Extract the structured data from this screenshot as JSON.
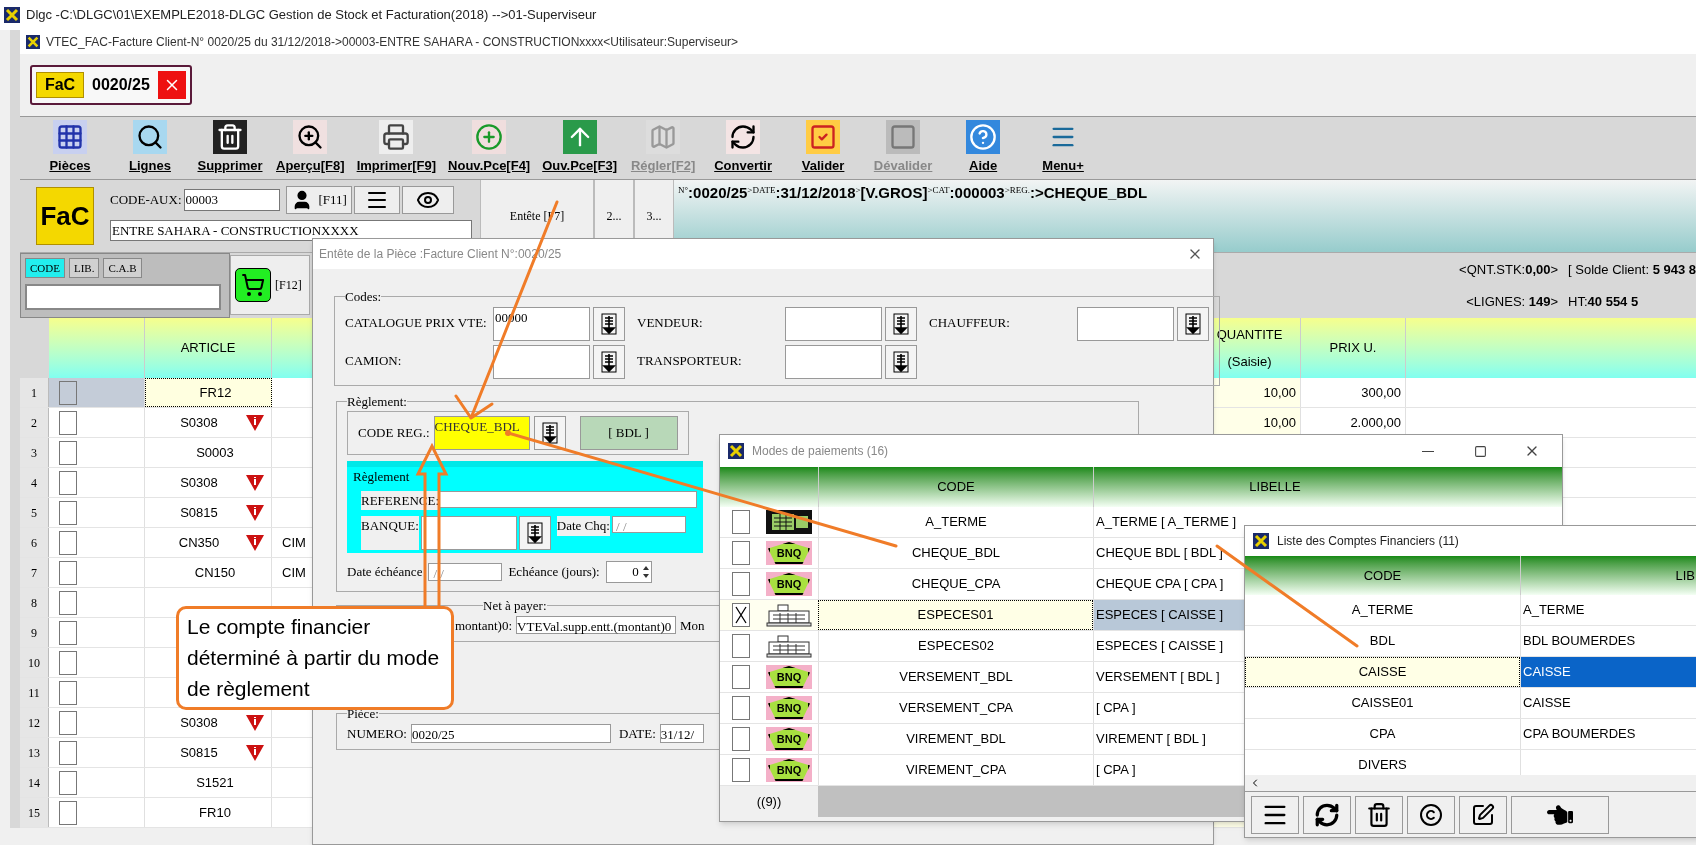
{
  "app_title": "Dlgc -C:\\DLGC\\01\\EXEMPLE2018-DLGC Gestion de Stock et Facturation(2018) -->01-Superviseur",
  "window_title": "VTEC_FAC-Facture Client-N° 0020/25 du 31/12/2018->00003-ENTRE SAHARA - CONSTRUCTIONxxxx<Utilisateur:Superviseur>",
  "doc_tab": {
    "logo": "FaC",
    "number": "0020/25"
  },
  "toolbar": [
    {
      "kind": "pieces",
      "label": "Pièces",
      "disabled": false
    },
    {
      "kind": "lines",
      "label": "Lignes",
      "disabled": false
    },
    {
      "kind": "delete",
      "label": "Supprimer",
      "disabled": false
    },
    {
      "kind": "preview",
      "label": "Aperçu[F8]",
      "disabled": false
    },
    {
      "kind": "print",
      "label": "Imprimer[F9]",
      "disabled": false
    },
    {
      "kind": "new",
      "label": "Nouv.Pce[F4]",
      "disabled": false
    },
    {
      "kind": "open",
      "label": "Ouv.Pce[F3]",
      "disabled": false
    },
    {
      "kind": "pay",
      "label": "Régler[F2]",
      "disabled": true
    },
    {
      "kind": "convert",
      "label": "Convertir",
      "disabled": false
    },
    {
      "kind": "validate",
      "label": "Valider",
      "disabled": false
    },
    {
      "kind": "unvalidate",
      "label": "Dévalider",
      "disabled": true
    },
    {
      "kind": "help",
      "label": "Aide",
      "disabled": false
    },
    {
      "kind": "menu",
      "label": "Menu+",
      "disabled": false
    }
  ],
  "header": {
    "logo": "FaC",
    "code_aux_label": "CODE-AUX:",
    "code_aux_value": "00003",
    "client_key": "[F11]",
    "client_name": "ENTRE SAHARA - CONSTRUCTIONXXXX",
    "tabs": [
      "Entête [F7]",
      "2...",
      "3..."
    ],
    "info": [
      {
        "kind": "small",
        "text": "N°"
      },
      {
        "kind": "big",
        "text": ":0020/25"
      },
      {
        "kind": "small",
        "text": ">DATE"
      },
      {
        "kind": "big",
        "text": ":31/12/2018"
      },
      {
        "kind": "small",
        "text": ">"
      },
      {
        "kind": "big",
        "text": "[V.GROS]"
      },
      {
        "kind": "small",
        "text": ">CAT"
      },
      {
        "kind": "big",
        "text": ":000003"
      },
      {
        "kind": "small",
        "text": ">REG."
      },
      {
        "kind": "big",
        "text": ":>CHEQUE_BDL"
      }
    ]
  },
  "search": {
    "modes": [
      {
        "label": "CODE",
        "selected": true
      },
      {
        "label": "LIB.",
        "selected": false
      },
      {
        "label": "C.A.B",
        "selected": false
      }
    ],
    "cart_key": "[F12]"
  },
  "stats": [
    "<QNT.STK:**0,00**>",
    "[ Solde Client: **5 943 8**",
    "<LIGNES: **149**>",
    "HT:**40 554 5**"
  ],
  "grid": {
    "columns": {
      "article": "ARTICLE",
      "quantity": "QUANTITE",
      "quantity_sub": "(Saisie)",
      "price": "PRIX U."
    },
    "rows": [
      {
        "num": "1",
        "selected": true,
        "checked": false,
        "article": "FR12",
        "alert": false,
        "quantity": "10,00",
        "price": "300,00"
      },
      {
        "num": "2",
        "selected": false,
        "checked": false,
        "article": "S0308",
        "alert": true,
        "quantity": "10,00",
        "price": "2.000,00"
      },
      {
        "num": "3",
        "selected": false,
        "checked": false,
        "article": "S0003",
        "alert": false
      },
      {
        "num": "4",
        "selected": false,
        "checked": false,
        "article": "S0308",
        "alert": true
      },
      {
        "num": "5",
        "selected": false,
        "checked": false,
        "article": "S0815",
        "alert": true
      },
      {
        "num": "6",
        "selected": false,
        "checked": false,
        "article": "CN350",
        "alert": true,
        "column_4": "CIM"
      },
      {
        "num": "7",
        "selected": false,
        "checked": false,
        "article": "CN150",
        "alert": false,
        "column_4": "CIM"
      },
      {
        "num": "8",
        "selected": false,
        "checked": false,
        "alert": false
      },
      {
        "num": "9",
        "selected": false,
        "checked": false,
        "alert": false
      },
      {
        "num": "10",
        "selected": false,
        "checked": false,
        "alert": false
      },
      {
        "num": "11",
        "selected": false,
        "checked": false,
        "alert": false
      },
      {
        "num": "12",
        "selected": false,
        "checked": false,
        "article": "S0308",
        "alert": true
      },
      {
        "num": "13",
        "selected": false,
        "checked": false,
        "article": "S0815",
        "alert": true
      },
      {
        "num": "14",
        "selected": false,
        "checked": false,
        "article": "S1521",
        "alert": false
      },
      {
        "num": "15",
        "selected": false,
        "checked": false,
        "article": "FR10",
        "alert": false
      }
    ]
  },
  "entete": {
    "title": "Entête de la Pièce :Facture Client N°:0020/25",
    "codes": {
      "legend": "Codes:",
      "fields": [
        {
          "label": "CATALOGUE PRIX VTE:",
          "value": "00000"
        },
        {
          "label": "VENDEUR:"
        },
        {
          "label": "CHAUFFEUR:"
        },
        {
          "label": "CAMION:"
        },
        {
          "label": "TRANSPORTEUR:"
        }
      ]
    },
    "reglement": {
      "legend": "Règlement:",
      "code_label": "CODE REG.:",
      "code_value": "CHEQUE_BDL",
      "account": "[ BDL ]",
      "sub_legend": "Règlement",
      "reference_label": "REFERENCE:",
      "bank_label": "BANQUE:",
      "cheque_date_label": "Date Chq:",
      "cheque_date": " / /",
      "due_label": "Date échéance",
      "due_date": "/ /",
      "days_label": "Echéance (jours):",
      "days": "0"
    },
    "net": {
      "legend": "Net à payer:",
      "label": "montant)0:",
      "value": "VTEVal.supp.entt.(montant)0",
      "label_2": "Mon"
    },
    "piece": {
      "legend": "Pièce:",
      "number_label": "NUMERO:",
      "number": "0020/25",
      "date_label": "DATE:",
      "date": "31/12/"
    }
  },
  "payment_modes": {
    "title": "Modes de paiements (16)",
    "columns": [
      "CODE",
      "LIBELLE"
    ],
    "rows": [
      {
        "kind": "term",
        "checked": false,
        "selected": false,
        "code": "A_TERME",
        "label": "A_TERME [ A_TERME ]"
      },
      {
        "kind": "bank",
        "badge": "BNQ",
        "checked": false,
        "selected": false,
        "code": "CHEQUE_BDL",
        "label": "CHEQUE BDL [ BDL ]"
      },
      {
        "kind": "bank",
        "badge": "BNQ",
        "checked": false,
        "selected": false,
        "code": "CHEQUE_CPA",
        "label": "CHEQUE CPA [ CPA ]"
      },
      {
        "kind": "cash",
        "checked": true,
        "selected": true,
        "code": "ESPECES01",
        "label": "ESPECES [ CAISSE ]"
      },
      {
        "kind": "cash",
        "checked": false,
        "selected": false,
        "code": "ESPECES02",
        "label": "ESPECES [ CAISSE ]"
      },
      {
        "kind": "bank",
        "badge": "BNQ",
        "checked": false,
        "selected": false,
        "code": "VERSEMENT_BDL",
        "label": "VERSEMENT [ BDL ]"
      },
      {
        "kind": "bank",
        "badge": "BNQ",
        "checked": false,
        "selected": false,
        "code": "VERSEMENT_CPA",
        "label": "[ CPA ]"
      },
      {
        "kind": "bank",
        "badge": "BNQ",
        "checked": false,
        "selected": false,
        "code": "VIREMENT_BDL",
        "label": "VIREMENT [ BDL ]"
      },
      {
        "kind": "bank",
        "badge": "BNQ",
        "checked": false,
        "selected": false,
        "code": "VIREMENT_CPA",
        "label": "[ CPA ]"
      }
    ],
    "footer": "((9))"
  },
  "accounts": {
    "title": "Liste des Comptes Financiers (11)",
    "columns": [
      "CODE",
      "LIB"
    ],
    "rows": [
      {
        "code": "A_TERME",
        "label": "A_TERME",
        "selected": false
      },
      {
        "code": "BDL",
        "label": "BDL  BOUMERDES",
        "selected": false
      },
      {
        "code": "CAISSE",
        "label": "CAISSE",
        "selected": true
      },
      {
        "code": "CAISSE01",
        "label": "CAISSE",
        "selected": false
      },
      {
        "code": "CPA",
        "label": "CPA BOUMERDES",
        "selected": false
      },
      {
        "code": "DIVERS",
        "selected": false
      }
    ]
  },
  "callout": "Le compte financier déterminé à partir du mode de règlement"
}
